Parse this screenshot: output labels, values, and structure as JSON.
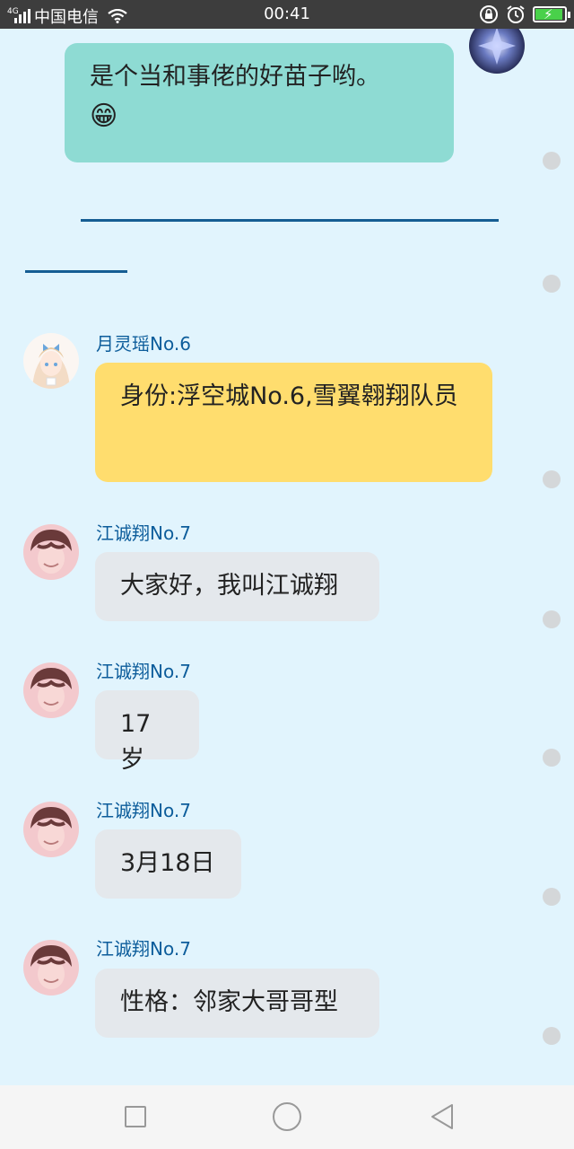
{
  "status": {
    "network": "4G",
    "carrier": "中国电信",
    "time": "00:41"
  },
  "messages": {
    "m0": {
      "text": "是个当和事佬的好苗子哟。",
      "emoji": "😁"
    },
    "m1": {
      "sender": "月灵瑶No.6",
      "text": "身份:浮空城No.6,雪翼翱翔队员"
    },
    "m2": {
      "sender": "江诚翔No.7",
      "text": "大家好，我叫江诚翔"
    },
    "m3": {
      "sender": "江诚翔No.7",
      "text": "17岁"
    },
    "m4": {
      "sender": "江诚翔No.7",
      "text": "3月18日"
    },
    "m5": {
      "sender": "江诚翔No.7",
      "text": "性格：邻家大哥哥型"
    }
  },
  "colors": {
    "background": "#e1f4fd",
    "sender_name": "#0d5d9b",
    "bubble_teal": "#8edbd3",
    "bubble_yellow": "#ffdd6e",
    "bubble_grey": "#e4e8ec",
    "divider": "#155d93"
  },
  "icons": {
    "status": [
      "signal-icon",
      "wifi-icon",
      "lock-rotation-icon",
      "alarm-icon",
      "battery-charging-icon"
    ],
    "nav": [
      "recent-apps-icon",
      "home-icon",
      "back-icon"
    ]
  }
}
